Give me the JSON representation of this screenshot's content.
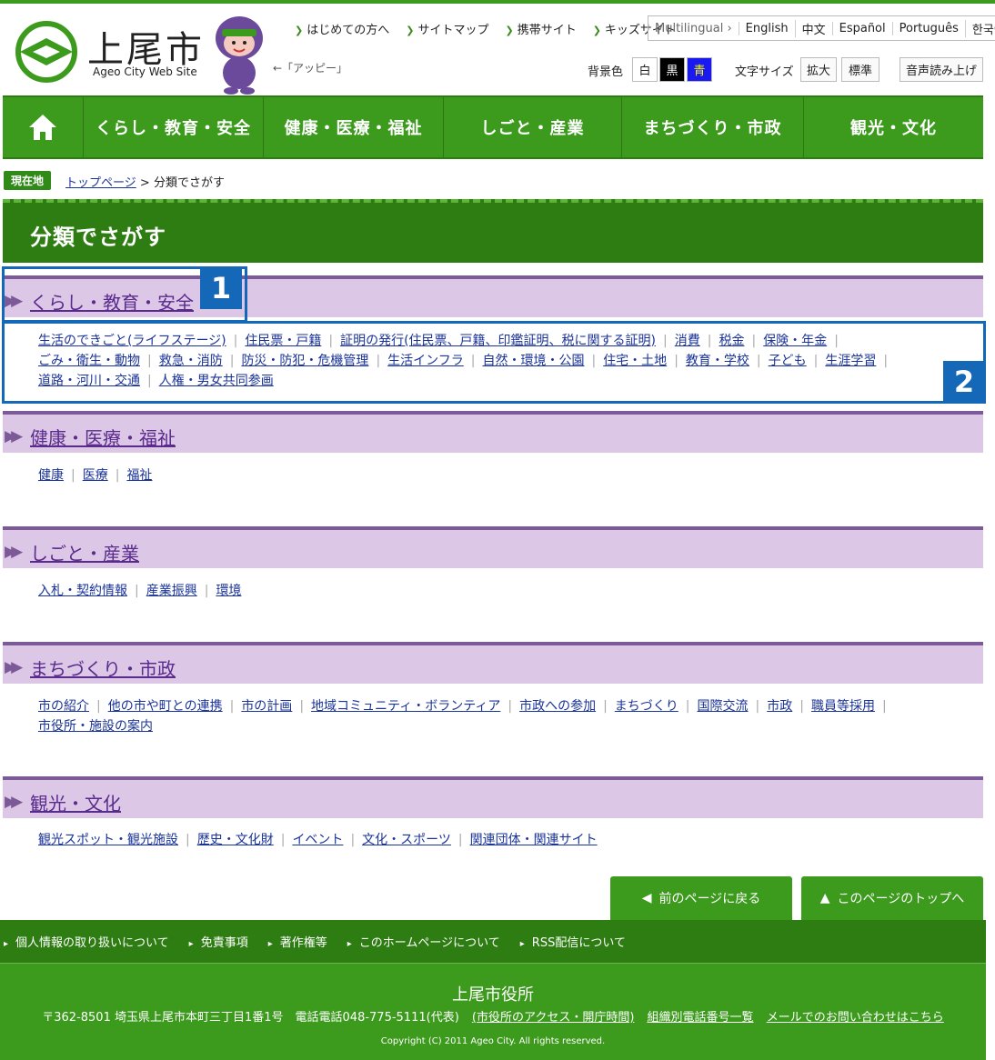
{
  "header": {
    "logo_title": "上尾市",
    "logo_sub": "Ageo City Web Site",
    "mascot_note": "←「アッピー」",
    "top_links": [
      "はじめての方へ",
      "サイトマップ",
      "携帯サイト",
      "キッズサイト"
    ],
    "languages": [
      "Multilingual ›",
      "English",
      "中文",
      "Español",
      "Português",
      "한국어"
    ],
    "bg_label": "背景色",
    "bg_options": [
      "白",
      "黒",
      "青"
    ],
    "fontsize_label": "文字サイズ",
    "fontsize_options": [
      "拡大",
      "標準"
    ],
    "voice_label": "音声読み上げ",
    "colors": {
      "green": "#3c9a1c",
      "dark_green": "#2e7d12",
      "purple": "#7c5a98",
      "lavender": "#dcc8e6"
    }
  },
  "nav": {
    "home_icon": "home-icon",
    "items": [
      "くらし・教育・安全",
      "健康・医療・福祉",
      "しごと・産業",
      "まちづくり・市政",
      "観光・文化"
    ]
  },
  "breadcrumb": {
    "label": "現在地",
    "top": "トップページ",
    "sep": ">",
    "current": "分類でさがす"
  },
  "page_title": "分類でさがす",
  "sections": [
    {
      "title": "くらし・教育・安全",
      "links": [
        "生活のできごと(ライフステージ)",
        "住民票・戸籍",
        "証明の発行(住民票、戸籍、印鑑証明、税に関する証明)",
        "消費",
        "税金",
        "保険・年金",
        "ごみ・衛生・動物",
        "救急・消防",
        "防災・防犯・危機管理",
        "生活インフラ",
        "自然・環境・公園",
        "住宅・土地",
        "教育・学校",
        "子ども",
        "生涯学習",
        "道路・河川・交通",
        "人権・男女共同参画"
      ]
    },
    {
      "title": "健康・医療・福祉",
      "links": [
        "健康",
        "医療",
        "福祉"
      ]
    },
    {
      "title": "しごと・産業",
      "links": [
        "入札・契約情報",
        "産業振興",
        "環境"
      ]
    },
    {
      "title": "まちづくり・市政",
      "links": [
        "市の紹介",
        "他の市や町との連携",
        "市の計画",
        "地域コミュニティ・ボランティア",
        "市政への参加",
        "まちづくり",
        "国際交流",
        "市政",
        "職員等採用",
        "市役所・施設の案内"
      ]
    },
    {
      "title": "観光・文化",
      "links": [
        "観光スポット・観光施設",
        "歴史・文化財",
        "イベント",
        "文化・スポーツ",
        "関連団体・関連サイト"
      ]
    }
  ],
  "callouts": [
    "1",
    "2"
  ],
  "footer_buttons": {
    "back": "前のページに戻る",
    "top": "このページのトップへ"
  },
  "footer_links": [
    "個人情報の取り扱いについて",
    "免責事項",
    "著作権等",
    "このホームページについて",
    "RSS配信について"
  ],
  "footer": {
    "name": "上尾市役所",
    "address": "〒362-8501 埼玉県上尾市本町三丁目1番1号　電話電話048-775-5111(代表)",
    "access_link": "(市役所のアクセス・開庁時間)",
    "phone_link": "組織別電話番号一覧",
    "mail_link": "メールでのお問い合わせはこちら",
    "copyright": "Copyright (C) 2011 Ageo City. All rights reserved."
  }
}
